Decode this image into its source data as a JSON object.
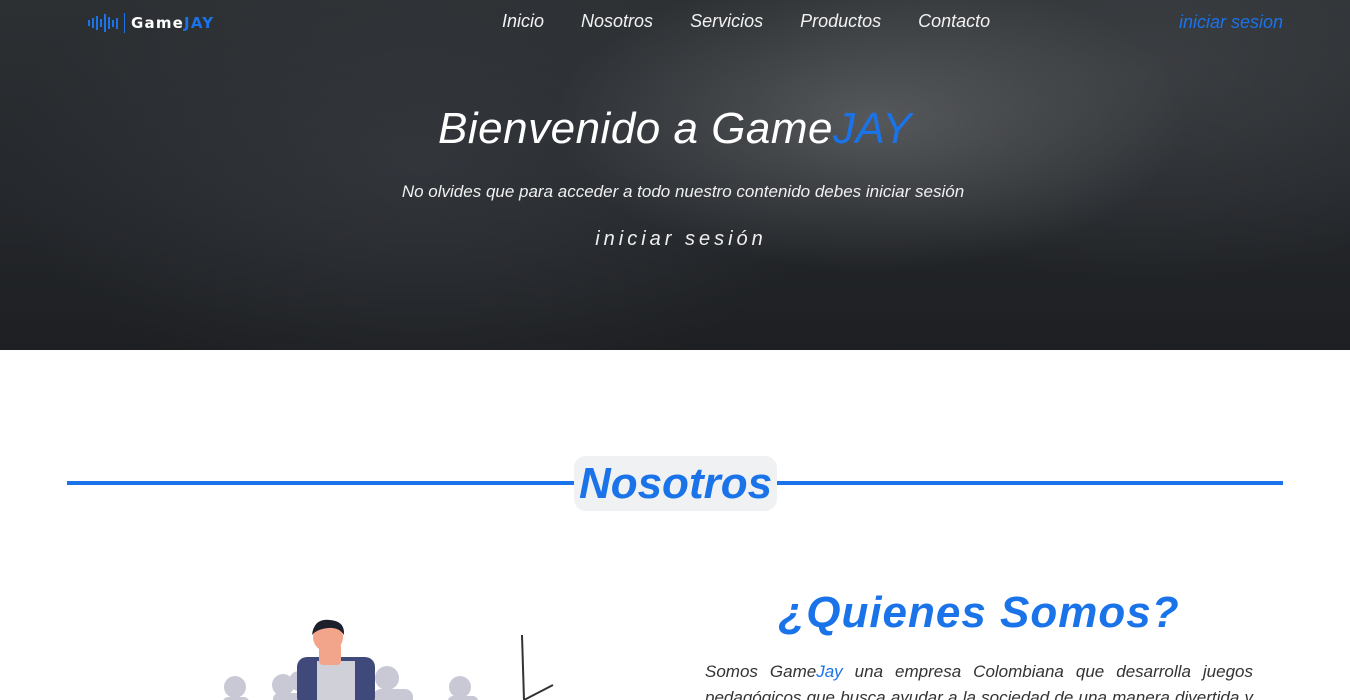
{
  "brand": {
    "name_part1": "Game",
    "name_part2": "JAY",
    "primary_color": "#1a73e8"
  },
  "nav": {
    "items": [
      {
        "label": "Inicio"
      },
      {
        "label": "Nosotros"
      },
      {
        "label": "Servicios"
      },
      {
        "label": "Productos"
      },
      {
        "label": "Contacto"
      }
    ],
    "login_label": "iniciar sesion"
  },
  "hero": {
    "title_part1": "Bienvenido a Game",
    "title_part2": "JAY",
    "subtitle": "No olvides que para acceder a todo nuestro contenido debes iniciar sesión",
    "cta_label": "iniciar sesión"
  },
  "nosotros": {
    "section_title": "Nosotros",
    "heading": "¿Quienes Somos?",
    "text_part1": "Somos Game",
    "text_part2": "Jay",
    "text_part3": " una empresa Colombiana que desarrolla juegos pedagógicos que busca ayudar a la sociedad de una manera divertida y"
  }
}
